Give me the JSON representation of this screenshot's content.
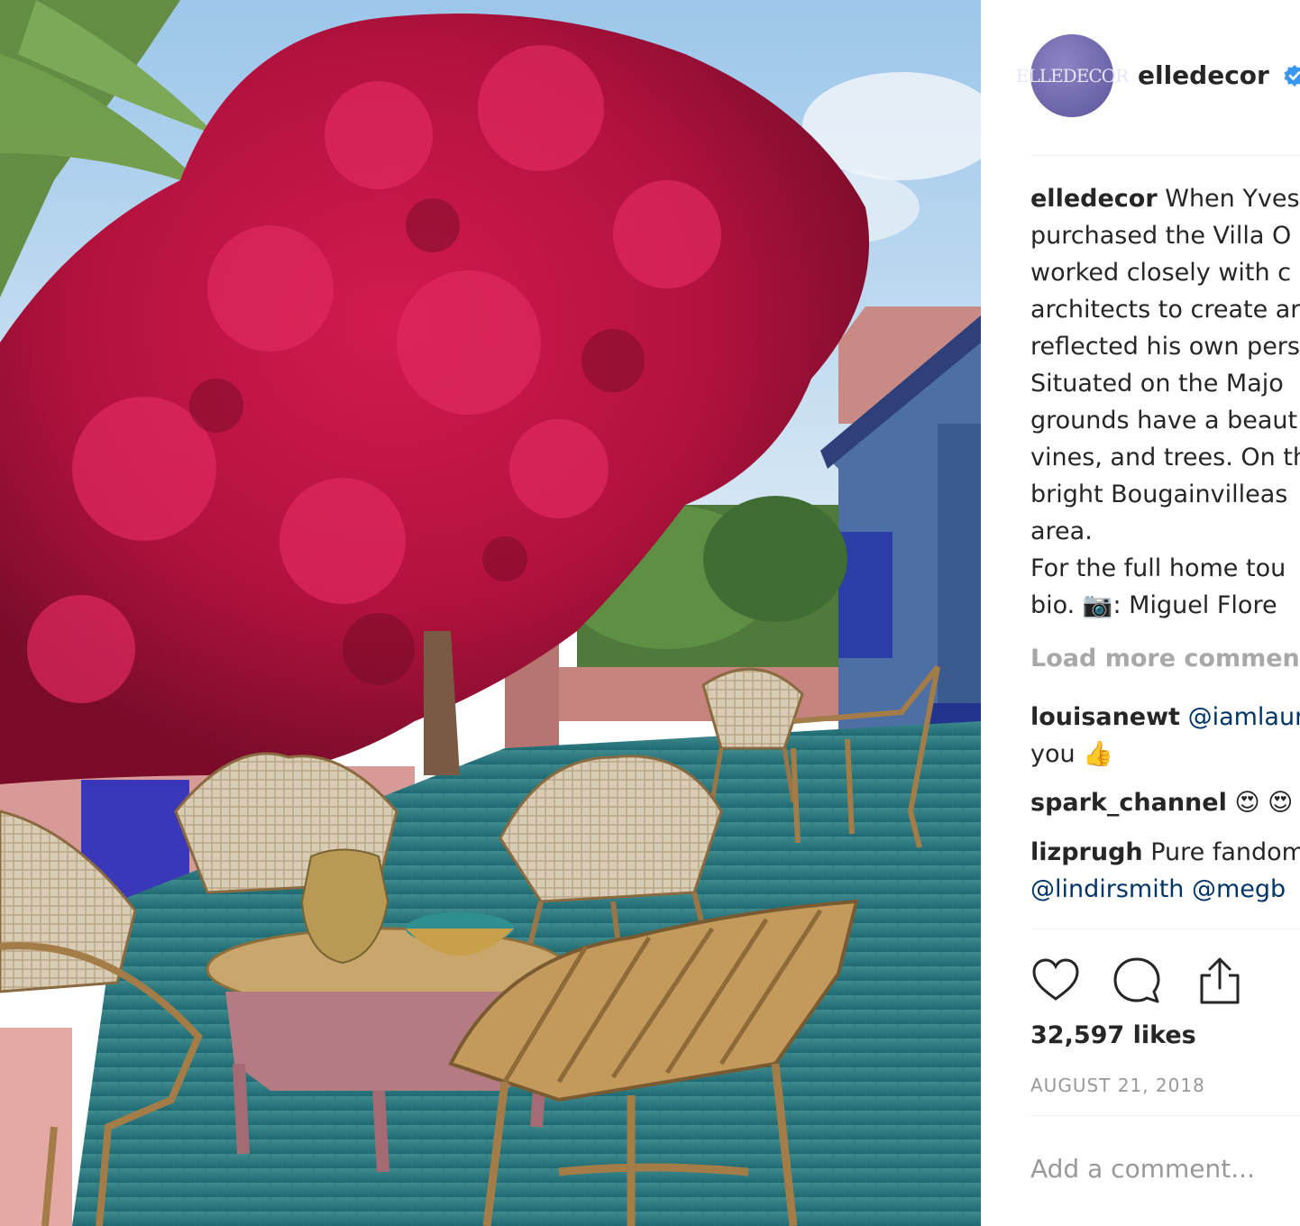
{
  "post": {
    "author_avatar_text": "ELLEDECOR",
    "author": "elledecor",
    "verified": true,
    "caption_lines": [
      "When Yves",
      "purchased the Villa O",
      "worked closely with c",
      "architects to create ar",
      "reflected his own pers",
      "Situated on the Majo",
      "grounds have a beaut",
      "vines, and trees. On th",
      "bright Bougainvilleas",
      "area.",
      "For the full home tou",
      "bio. 📷: Miguel Flore"
    ],
    "load_more_label": "Load more comment",
    "comments": [
      {
        "user": "louisanewt",
        "text": "@iamlaur",
        "text2": "you 👍"
      },
      {
        "user": "spark_channel",
        "text": "😍 😍"
      },
      {
        "user": "lizprugh",
        "text": "Pure fandom",
        "text2": "@lindirsmith @megb"
      }
    ],
    "likes": "32,597 likes",
    "date": "AUGUST 21, 2018",
    "add_comment_placeholder": "Add a comment..."
  },
  "icons": {
    "like": "heart-icon",
    "comment": "comment-icon",
    "share": "share-icon",
    "verified": "verified-badge-icon"
  },
  "colors": {
    "verified_blue": "#3897f0",
    "avatar_purple": "#6f68ad",
    "mention_blue": "#003569",
    "muted_gray": "#999999"
  }
}
